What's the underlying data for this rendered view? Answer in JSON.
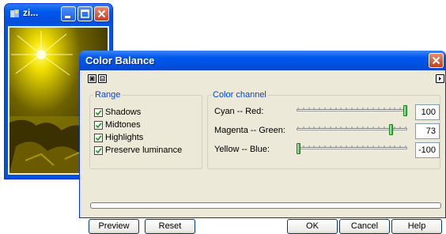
{
  "image_window": {
    "title": "zi...",
    "minimize_icon": "minimize-icon",
    "maximize_icon": "maximize-icon",
    "close_icon": "close-icon"
  },
  "dialog": {
    "title": "Color Balance",
    "close_icon": "close-icon",
    "toolbar_icons": [
      "expand-icon",
      "collapse-icon"
    ],
    "menu_arrow_icon": "arrow-right-icon"
  },
  "range": {
    "legend": "Range",
    "options": [
      {
        "label": "Shadows",
        "checked": true
      },
      {
        "label": "Midtones",
        "checked": true
      },
      {
        "label": "Highlights",
        "checked": true
      },
      {
        "label": "Preserve luminance",
        "checked": true
      }
    ]
  },
  "color_channel": {
    "legend": "Color channel",
    "min": -100,
    "max": 100,
    "channels": [
      {
        "label": "Cyan -- Red:",
        "value": "100"
      },
      {
        "label": "Magenta -- Green:",
        "value": "73"
      },
      {
        "label": "Yellow -- Blue:",
        "value": "-100"
      }
    ]
  },
  "progress": 0,
  "buttons": {
    "preview": "Preview",
    "reset": "Reset",
    "ok": "OK",
    "cancel": "Cancel",
    "help": "Help"
  },
  "colors": {
    "titlebar": "#0054e3",
    "dialog_bg": "#ece9d8",
    "group_legend": "#0046d5",
    "close_red": "#c73c17"
  }
}
